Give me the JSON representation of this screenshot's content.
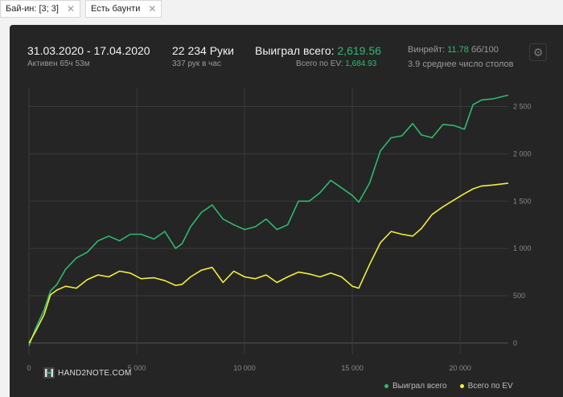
{
  "filters": [
    {
      "label": "Бай-ин: [3; 3]"
    },
    {
      "label": "Есть баунти"
    }
  ],
  "stats": {
    "date_range": "31.03.2020 - 17.04.2020",
    "active": "Активен 65ч 53м",
    "hands": "22 234 Руки",
    "hands_per_hour": "337 рук в час",
    "won_label": "Выиграл всего:",
    "won_value": "2,619.56",
    "ev_label": "Всего по EV:",
    "ev_value": "1,684.93",
    "winrate_label": "Винрейт:",
    "winrate_value": "11.78",
    "winrate_unit": "бб/100",
    "tables": "3.9 среднее число столов"
  },
  "logo": "HAND2NOTE.COM",
  "colors": {
    "won": "#2dbb6e",
    "ev": "#f2ee3d",
    "grid": "#3a3a3a",
    "axis_text": "#888888"
  },
  "chart_data": {
    "type": "line",
    "xlim": [
      0,
      22234
    ],
    "ylim": [
      -120,
      2700
    ],
    "x_ticks": [
      0,
      5000,
      10000,
      15000,
      20000
    ],
    "x_tick_labels": [
      "0",
      "5 000",
      "10 000",
      "15 000",
      "20 000"
    ],
    "y_ticks": [
      0,
      500,
      1000,
      1500,
      2000,
      2500
    ],
    "y_tick_labels": [
      "0",
      "500",
      "1 000",
      "1 500",
      "2 000",
      "2 500"
    ],
    "grid": true,
    "legend": "bottom-right",
    "series": [
      {
        "name": "Выиграл всего",
        "x": [
          0,
          300,
          700,
          1000,
          1300,
          1700,
          2200,
          2700,
          3200,
          3700,
          4200,
          4700,
          5200,
          5800,
          6300,
          6800,
          7100,
          7500,
          8000,
          8500,
          9000,
          9500,
          10000,
          10500,
          11000,
          11500,
          12000,
          12500,
          13000,
          13500,
          14000,
          14500,
          15000,
          15300,
          15800,
          16300,
          16800,
          17300,
          17800,
          18200,
          18700,
          19200,
          19700,
          20200,
          20600,
          21000,
          21500,
          22234
        ],
        "y": [
          -30,
          150,
          350,
          550,
          620,
          780,
          900,
          960,
          1080,
          1130,
          1080,
          1150,
          1150,
          1100,
          1180,
          1000,
          1050,
          1230,
          1380,
          1460,
          1310,
          1250,
          1200,
          1230,
          1310,
          1200,
          1250,
          1500,
          1500,
          1590,
          1720,
          1640,
          1560,
          1490,
          1690,
          2030,
          2170,
          2190,
          2320,
          2200,
          2170,
          2310,
          2300,
          2260,
          2520,
          2570,
          2580,
          2620
        ]
      },
      {
        "name": "Всего по EV",
        "x": [
          0,
          300,
          700,
          1000,
          1300,
          1700,
          2200,
          2700,
          3200,
          3700,
          4200,
          4700,
          5200,
          5800,
          6300,
          6800,
          7100,
          7500,
          8000,
          8500,
          9000,
          9500,
          10000,
          10500,
          11000,
          11500,
          12000,
          12500,
          13000,
          13500,
          14000,
          14500,
          15000,
          15300,
          15800,
          16300,
          16800,
          17300,
          17800,
          18200,
          18700,
          19200,
          19700,
          20200,
          20600,
          21000,
          21500,
          22234
        ],
        "y": [
          0,
          120,
          300,
          510,
          560,
          600,
          580,
          670,
          720,
          700,
          760,
          740,
          680,
          690,
          660,
          610,
          620,
          700,
          770,
          800,
          640,
          760,
          700,
          680,
          720,
          640,
          700,
          750,
          730,
          700,
          740,
          700,
          600,
          580,
          830,
          1060,
          1180,
          1150,
          1130,
          1210,
          1360,
          1440,
          1510,
          1580,
          1630,
          1660,
          1670,
          1690
        ]
      }
    ]
  }
}
